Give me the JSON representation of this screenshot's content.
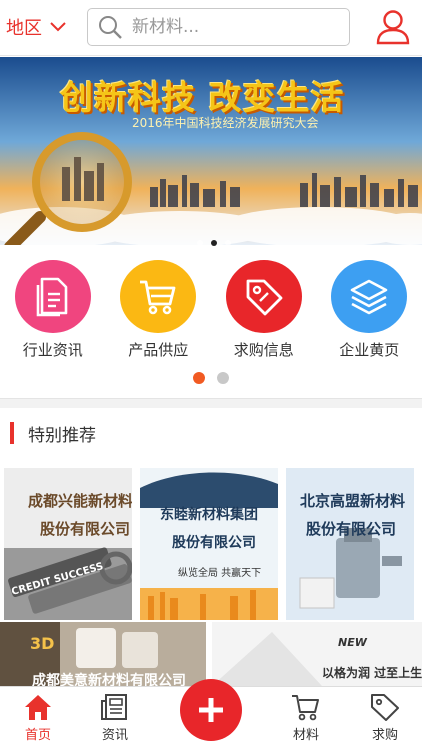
{
  "header": {
    "region_label": "地区",
    "search_placeholder": "新材料..."
  },
  "banner": {
    "title": "创新科技 改变生活",
    "subtitle": "2016年中国科技经济发展研究大会",
    "slide_count": 3,
    "active_slide": 2
  },
  "categories": [
    {
      "label": "行业资讯",
      "icon": "document-icon",
      "color": "#f0457f"
    },
    {
      "label": "产品供应",
      "icon": "cart-icon",
      "color": "#fbb813"
    },
    {
      "label": "求购信息",
      "icon": "tag-icon",
      "color": "#e8262a"
    },
    {
      "label": "企业黄页",
      "icon": "layers-icon",
      "color": "#3d9ff2"
    }
  ],
  "category_pages": 2,
  "category_active_page": 1,
  "section": {
    "title": "特别推荐"
  },
  "recommend": [
    {
      "line1": "成都兴能新材料",
      "line2": "股份有限公司",
      "extra": "CREDIT SUCCESS"
    },
    {
      "line1": "东睦新材料集团",
      "line2": "股份有限公司",
      "extra": "纵览全局 共赢天下"
    },
    {
      "line1": "北京高盟新材料",
      "line2": "股份有限公司",
      "extra": ""
    }
  ],
  "recommend_row2": [
    {
      "line1": "成都美意新材料有限公司",
      "badge": "3D"
    },
    {
      "line1": "以格为润 过至上生活",
      "badge": "NEW"
    }
  ],
  "tabbar": {
    "home": "首页",
    "news": "资讯",
    "materials": "材料",
    "purchase": "求购"
  },
  "colors": {
    "accent": "#e8322c",
    "pager_active": "#f15a22"
  }
}
